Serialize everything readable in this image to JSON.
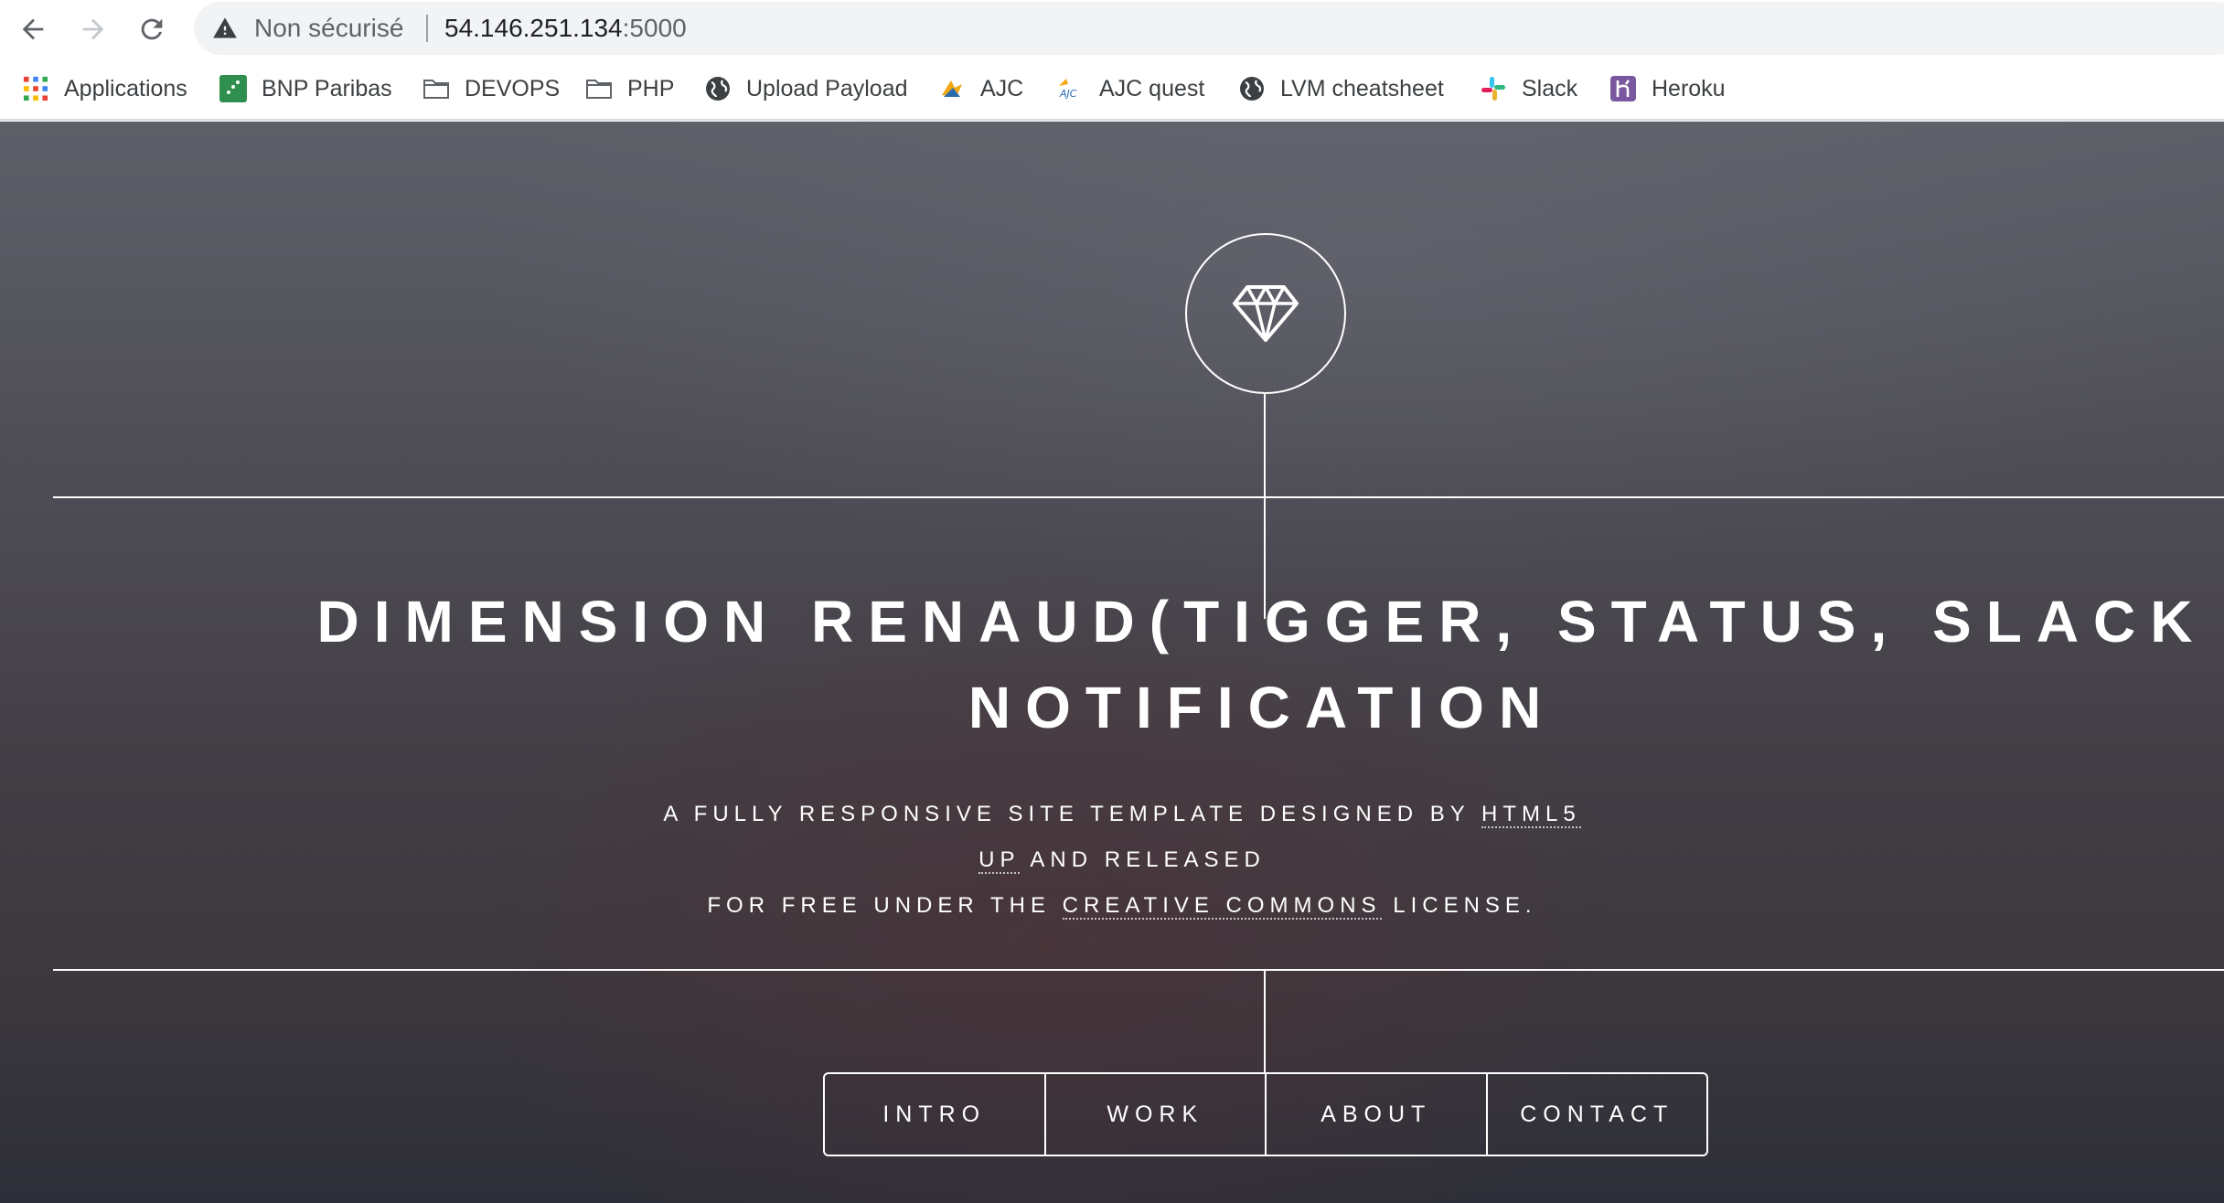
{
  "browser": {
    "security_label": "Non sécurisé",
    "url_host": "54.146.251.134",
    "url_port": ":5000"
  },
  "bookmarks": [
    {
      "label": "Applications",
      "icon": "apps-grid-icon"
    },
    {
      "label": "BNP Paribas",
      "icon": "bnp-favicon"
    },
    {
      "label": "DEVOPS",
      "icon": "folder-icon"
    },
    {
      "label": "PHP",
      "icon": "folder-icon"
    },
    {
      "label": "Upload Payload",
      "icon": "globe-icon"
    },
    {
      "label": "AJC",
      "icon": "ajc-favicon"
    },
    {
      "label": "AJC quest",
      "icon": "ajc-favicon"
    },
    {
      "label": "LVM cheatsheet",
      "icon": "globe-icon"
    },
    {
      "label": "Slack",
      "icon": "slack-favicon"
    },
    {
      "label": "Heroku",
      "icon": "heroku-favicon"
    }
  ],
  "header": {
    "title_line1": "DIMENSION RENAUD(TIGGER, STATUS, SLACK",
    "title_line2": "NOTIFICATION",
    "tagline_part1": "A fully responsive site template designed by ",
    "tagline_link1": "HTML5 UP",
    "tagline_part2": " and released",
    "tagline_part3": "for free under the ",
    "tagline_link2": "Creative Commons",
    "tagline_part4": " license."
  },
  "nav": [
    "Intro",
    "Work",
    "About",
    "Contact"
  ],
  "colors": {
    "page_gradient_top": "#5e6069",
    "page_gradient_bottom": "#2e2f39",
    "line_color": "#ffffff"
  }
}
